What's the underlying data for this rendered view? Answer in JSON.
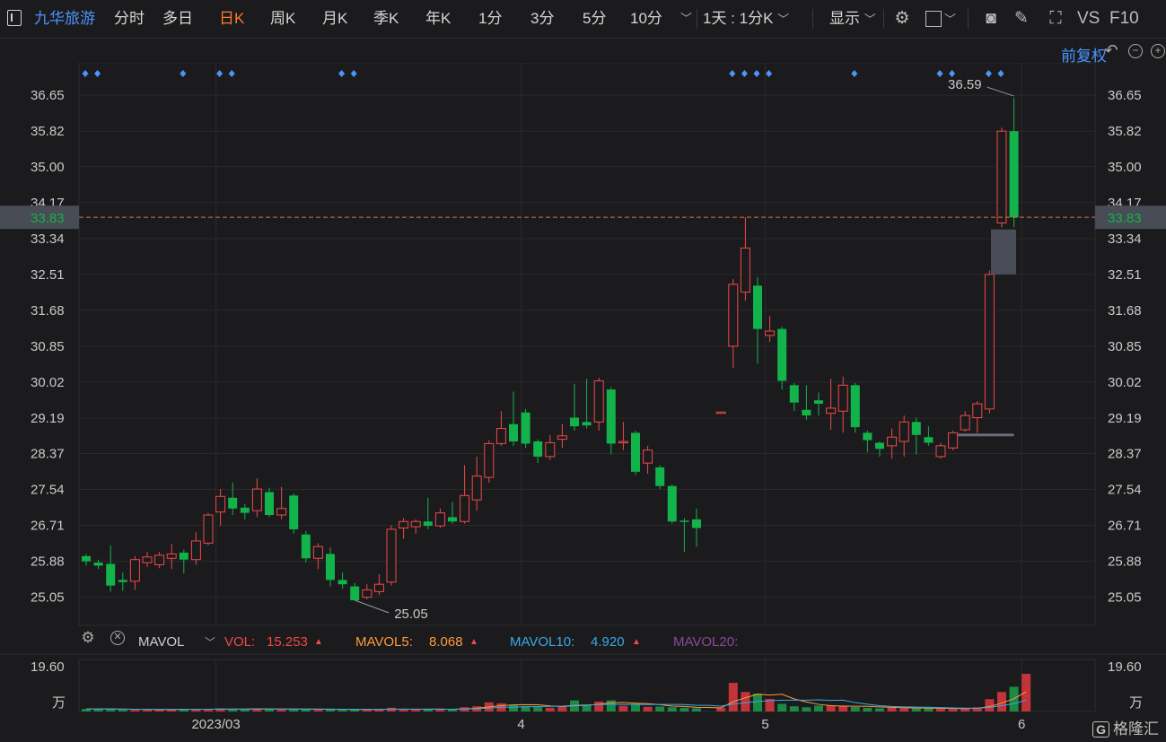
{
  "toolbar": {
    "stock_name": "九华旅游",
    "periods": [
      "分时",
      "多日",
      "日K",
      "周K",
      "月K",
      "季K",
      "年K",
      "1分",
      "3分",
      "5分",
      "10分"
    ],
    "active_period": "日K",
    "more_chevron": "﹀",
    "interval_select": "1天 : 1分K",
    "display_label": "显示",
    "vs_label": "VS",
    "f10_label": "F10",
    "adjust_label": "前复权"
  },
  "colors": {
    "up": "#f04848",
    "down": "#13b34b",
    "accent": "#4b95ff",
    "active": "#ff7a2d",
    "price_line": "#e0743c"
  },
  "price_axis": {
    "ticks": [
      "36.65",
      "35.82",
      "35.00",
      "34.17",
      "33.34",
      "32.51",
      "31.68",
      "30.85",
      "30.02",
      "29.19",
      "28.37",
      "27.54",
      "26.71",
      "25.88",
      "25.05"
    ],
    "current_price": "33.83",
    "high_label": "36.59",
    "low_label": "25.05"
  },
  "date_axis": [
    "2023/03",
    "4",
    "5",
    "6"
  ],
  "volume": {
    "indicator": "MAVOL",
    "vol_label": "VOL:",
    "vol_value": "15.253",
    "mavol5_label": "MAVOL5:",
    "mavol5_value": "8.068",
    "mavol10_label": "MAVOL10:",
    "mavol10_value": "4.920",
    "mavol20_label": "MAVOL20:",
    "axis_top": "19.60",
    "axis_unit": "万",
    "colors": {
      "mavol5": "#ff9a3c",
      "mavol10": "#3aa8e6",
      "mavol20": "#8a4a9a"
    }
  },
  "watermark": {
    "badge": "G",
    "text": "格隆汇"
  },
  "chart_data": {
    "type": "candlestick",
    "title": "九华旅游",
    "ylim": [
      24.4,
      37.4
    ],
    "candles": [
      {
        "x": 1,
        "o": 26.0,
        "c": 25.88,
        "h": 26.05,
        "l": 25.78
      },
      {
        "x": 2,
        "o": 25.85,
        "c": 25.78,
        "h": 25.92,
        "l": 25.7
      },
      {
        "x": 3,
        "o": 25.82,
        "c": 25.32,
        "h": 26.25,
        "l": 25.18
      },
      {
        "x": 4,
        "o": 25.45,
        "c": 25.4,
        "h": 25.62,
        "l": 25.2
      },
      {
        "x": 5,
        "o": 25.42,
        "c": 25.92,
        "h": 26.0,
        "l": 25.22
      },
      {
        "x": 6,
        "o": 25.85,
        "c": 25.98,
        "h": 26.1,
        "l": 25.75
      },
      {
        "x": 7,
        "o": 25.8,
        "c": 26.02,
        "h": 26.1,
        "l": 25.72
      },
      {
        "x": 8,
        "o": 25.95,
        "c": 26.05,
        "h": 26.28,
        "l": 25.7
      },
      {
        "x": 9,
        "o": 26.08,
        "c": 25.92,
        "h": 26.15,
        "l": 25.6
      },
      {
        "x": 10,
        "o": 25.92,
        "c": 26.35,
        "h": 26.55,
        "l": 25.8
      },
      {
        "x": 11,
        "o": 26.3,
        "c": 26.95,
        "h": 27.0,
        "l": 26.25
      },
      {
        "x": 12,
        "o": 27.02,
        "c": 27.38,
        "h": 27.55,
        "l": 26.7
      },
      {
        "x": 13,
        "o": 27.35,
        "c": 27.1,
        "h": 27.7,
        "l": 26.95
      },
      {
        "x": 14,
        "o": 27.12,
        "c": 27.0,
        "h": 27.2,
        "l": 26.85
      },
      {
        "x": 15,
        "o": 27.05,
        "c": 27.55,
        "h": 27.8,
        "l": 26.9
      },
      {
        "x": 16,
        "o": 27.48,
        "c": 26.95,
        "h": 27.58,
        "l": 26.9
      },
      {
        "x": 17,
        "o": 26.95,
        "c": 27.1,
        "h": 27.6,
        "l": 26.85
      },
      {
        "x": 18,
        "o": 27.4,
        "c": 26.62,
        "h": 27.45,
        "l": 26.52
      },
      {
        "x": 19,
        "o": 26.5,
        "c": 25.95,
        "h": 26.58,
        "l": 25.85
      },
      {
        "x": 20,
        "o": 25.95,
        "c": 26.22,
        "h": 26.3,
        "l": 25.7
      },
      {
        "x": 21,
        "o": 26.05,
        "c": 25.45,
        "h": 26.2,
        "l": 25.3
      },
      {
        "x": 22,
        "o": 25.45,
        "c": 25.35,
        "h": 25.62,
        "l": 25.25
      },
      {
        "x": 23,
        "o": 25.3,
        "c": 24.98,
        "h": 25.38,
        "l": 24.98
      },
      {
        "x": 24,
        "o": 25.05,
        "c": 25.22,
        "h": 25.35,
        "l": 25.0
      },
      {
        "x": 25,
        "o": 25.18,
        "c": 25.35,
        "h": 25.58,
        "l": 25.1
      },
      {
        "x": 26,
        "o": 25.4,
        "c": 26.62,
        "h": 26.72,
        "l": 25.32
      },
      {
        "x": 27,
        "o": 26.65,
        "c": 26.8,
        "h": 26.88,
        "l": 26.4
      },
      {
        "x": 28,
        "o": 26.68,
        "c": 26.8,
        "h": 26.85,
        "l": 26.52
      },
      {
        "x": 29,
        "o": 26.8,
        "c": 26.7,
        "h": 27.35,
        "l": 26.62
      },
      {
        "x": 30,
        "o": 26.7,
        "c": 27.0,
        "h": 27.1,
        "l": 26.65
      },
      {
        "x": 31,
        "o": 26.9,
        "c": 26.8,
        "h": 27.25,
        "l": 26.75
      },
      {
        "x": 32,
        "o": 26.8,
        "c": 27.4,
        "h": 28.1,
        "l": 26.75
      },
      {
        "x": 33,
        "o": 27.3,
        "c": 27.85,
        "h": 28.3,
        "l": 27.05
      },
      {
        "x": 34,
        "o": 27.82,
        "c": 28.6,
        "h": 28.68,
        "l": 27.7
      },
      {
        "x": 35,
        "o": 28.6,
        "c": 28.95,
        "h": 29.35,
        "l": 28.55
      },
      {
        "x": 36,
        "o": 29.05,
        "c": 28.65,
        "h": 29.8,
        "l": 28.55
      },
      {
        "x": 37,
        "o": 29.32,
        "c": 28.6,
        "h": 29.4,
        "l": 28.5
      },
      {
        "x": 38,
        "o": 28.65,
        "c": 28.3,
        "h": 28.7,
        "l": 28.15
      },
      {
        "x": 39,
        "o": 28.3,
        "c": 28.62,
        "h": 28.8,
        "l": 28.22
      },
      {
        "x": 40,
        "o": 28.7,
        "c": 28.78,
        "h": 29.05,
        "l": 28.5
      },
      {
        "x": 41,
        "o": 29.2,
        "c": 29.0,
        "h": 29.98,
        "l": 28.9
      },
      {
        "x": 42,
        "o": 29.1,
        "c": 29.02,
        "h": 30.1,
        "l": 28.95
      },
      {
        "x": 43,
        "o": 29.1,
        "c": 30.05,
        "h": 30.12,
        "l": 28.9
      },
      {
        "x": 44,
        "o": 29.85,
        "c": 28.6,
        "h": 29.9,
        "l": 28.35
      },
      {
        "x": 45,
        "o": 28.62,
        "c": 28.65,
        "h": 29.1,
        "l": 28.45
      },
      {
        "x": 46,
        "o": 28.85,
        "c": 27.95,
        "h": 28.9,
        "l": 27.88
      },
      {
        "x": 47,
        "o": 28.15,
        "c": 28.45,
        "h": 28.55,
        "l": 27.9
      },
      {
        "x": 48,
        "o": 28.05,
        "c": 27.62,
        "h": 28.1,
        "l": 27.55
      },
      {
        "x": 49,
        "o": 27.62,
        "c": 26.8,
        "h": 27.65,
        "l": 26.75
      },
      {
        "x": 50,
        "o": 26.82,
        "c": 26.8,
        "h": 26.88,
        "l": 26.1
      },
      {
        "x": 51,
        "o": 26.85,
        "c": 26.65,
        "h": 27.1,
        "l": 26.22
      },
      {
        "x": 53,
        "o": 29.33,
        "c": 29.33,
        "h": 29.33,
        "l": 29.33
      },
      {
        "x": 54,
        "o": 30.85,
        "c": 32.28,
        "h": 32.4,
        "l": 30.35
      },
      {
        "x": 55,
        "o": 32.1,
        "c": 33.12,
        "h": 33.83,
        "l": 31.9
      },
      {
        "x": 56,
        "o": 32.25,
        "c": 31.25,
        "h": 32.45,
        "l": 30.45
      },
      {
        "x": 57,
        "o": 31.1,
        "c": 31.2,
        "h": 31.55,
        "l": 30.95
      },
      {
        "x": 58,
        "o": 31.25,
        "c": 30.05,
        "h": 31.3,
        "l": 29.85
      },
      {
        "x": 59,
        "o": 29.95,
        "c": 29.55,
        "h": 30.0,
        "l": 29.35
      },
      {
        "x": 60,
        "o": 29.38,
        "c": 29.25,
        "h": 29.95,
        "l": 29.15
      },
      {
        "x": 61,
        "o": 29.6,
        "c": 29.52,
        "h": 29.78,
        "l": 29.25
      },
      {
        "x": 62,
        "o": 29.3,
        "c": 29.42,
        "h": 30.1,
        "l": 28.92
      },
      {
        "x": 63,
        "o": 29.35,
        "c": 29.95,
        "h": 30.15,
        "l": 28.85
      },
      {
        "x": 64,
        "o": 29.95,
        "c": 28.98,
        "h": 30.0,
        "l": 28.85
      },
      {
        "x": 65,
        "o": 28.85,
        "c": 28.68,
        "h": 28.9,
        "l": 28.4
      },
      {
        "x": 66,
        "o": 28.62,
        "c": 28.48,
        "h": 28.65,
        "l": 28.3
      },
      {
        "x": 67,
        "o": 28.55,
        "c": 28.75,
        "h": 28.95,
        "l": 28.25
      },
      {
        "x": 68,
        "o": 28.65,
        "c": 29.1,
        "h": 29.25,
        "l": 28.3
      },
      {
        "x": 69,
        "o": 29.1,
        "c": 28.8,
        "h": 29.2,
        "l": 28.35
      },
      {
        "x": 70,
        "o": 28.75,
        "c": 28.62,
        "h": 29.0,
        "l": 28.55
      },
      {
        "x": 71,
        "o": 28.3,
        "c": 28.55,
        "h": 28.62,
        "l": 28.25
      },
      {
        "x": 72,
        "o": 28.5,
        "c": 28.85,
        "h": 28.9,
        "l": 28.45
      },
      {
        "x": 73,
        "o": 28.92,
        "c": 29.25,
        "h": 29.35,
        "l": 28.88
      },
      {
        "x": 74,
        "o": 29.2,
        "c": 29.52,
        "h": 29.58,
        "l": 28.85
      },
      {
        "x": 75,
        "o": 29.4,
        "c": 32.51,
        "h": 32.6,
        "l": 29.3
      },
      {
        "x": 76,
        "o": 33.7,
        "c": 35.82,
        "h": 35.9,
        "l": 33.6
      },
      {
        "x": 77,
        "o": 35.82,
        "c": 33.83,
        "h": 36.59,
        "l": 33.6
      }
    ],
    "volume_ylim": [
      0,
      19.6
    ],
    "volume": [
      1.0,
      1.2,
      0.9,
      0.7,
      0.8,
      0.8,
      0.7,
      0.9,
      1.0,
      0.8,
      1.1,
      1.2,
      1.0,
      1.0,
      1.1,
      0.9,
      0.9,
      1.0,
      0.9,
      0.8,
      0.8,
      0.7,
      0.9,
      0.8,
      0.8,
      1.5,
      0.8,
      0.9,
      0.8,
      1.0,
      0.9,
      1.7,
      2.1,
      3.7,
      3.3,
      2.6,
      2.2,
      1.8,
      1.5,
      1.9,
      4.5,
      2.8,
      4.0,
      4.5,
      2.3,
      3.1,
      1.9,
      2.0,
      1.7,
      1.5,
      1.3,
      0,
      1.4,
      11.6,
      7.9,
      7.2,
      5.1,
      3.1,
      2.1,
      1.7,
      2.4,
      2.5,
      2.3,
      1.8,
      1.5,
      1.3,
      1.6,
      1.4,
      1.2,
      1.2,
      1.1,
      1.0,
      1.3,
      1.7,
      5.0,
      7.9,
      10.0,
      15.253
    ]
  }
}
